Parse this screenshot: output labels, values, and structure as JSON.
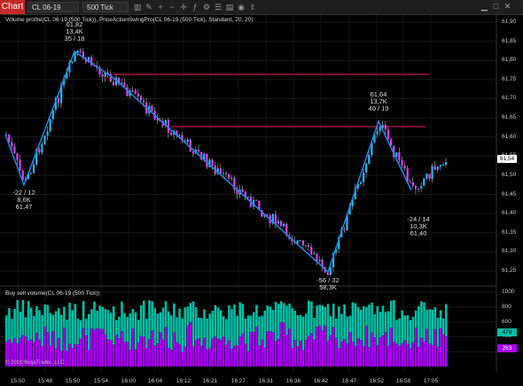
{
  "toolbar": {
    "tab_label": "Chart",
    "instrument": "CL 06-19",
    "interval": "500 Tick"
  },
  "main_panel": {
    "indicator_label": "Volume profile(CL 06-19 (500 Tick)), PriceActionSwingPro(CL 06-19 (500 Tick), Standard, 20, 20)",
    "price_axis": [
      "61,90",
      "61,85",
      "61,80",
      "61,75",
      "61,70",
      "61,65",
      "61,60",
      "61,55",
      "61,50",
      "61,45",
      "61,40",
      "61,35",
      "61,30",
      "61,25"
    ],
    "current_price": "61,54",
    "annotations": {
      "swing_low_1": [
        "-22 / 12",
        "8,6K",
        "61,47"
      ],
      "swing_high_1": [
        "61,82",
        "13,4K",
        "35 / 18"
      ],
      "swing_high_2": [
        "61,64",
        "13,7K",
        "40 / 19"
      ],
      "swing_low_2": [
        "-56 / 32",
        "58,3K"
      ],
      "swing_low_3": [
        "-24 / 14",
        "10,3K",
        "61,40"
      ]
    }
  },
  "volume_panel": {
    "label": "Buy sell volume(CL 06-19 (500 Tick))",
    "axis": [
      "1000",
      "800",
      "600",
      "400",
      "200"
    ],
    "buy_value": "478",
    "sell_value": "263",
    "copyright": "© 2019 NinjaTrader, LLC"
  },
  "time_axis": [
    "15:50",
    "15:48",
    "15:50",
    "15:54",
    "16:00",
    "16:04",
    "16:12",
    "16:21",
    "16:27",
    "16:31",
    "16:36",
    "16:42",
    "16:47",
    "16:52",
    "16:58",
    "17:05"
  ],
  "colors": {
    "bull_candle": "#29b6f6",
    "bear_candle": "#e040fb",
    "swing_line": "#1e88e5",
    "resistance": "#e91e63",
    "buy_volume": "#00bfa5",
    "sell_volume": "#aa00ff",
    "tab_red": "#c62828"
  }
}
